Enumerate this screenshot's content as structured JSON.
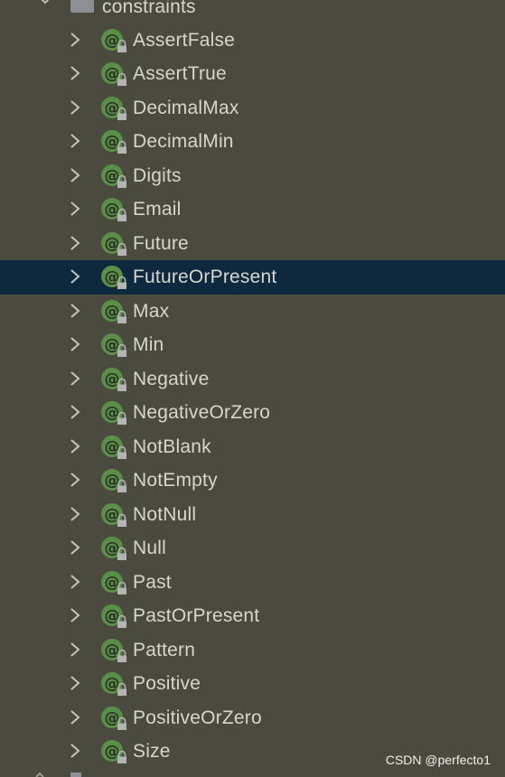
{
  "tree": {
    "folder": {
      "label": "constraints",
      "icon": "folder-icon",
      "expanded": true
    },
    "items": [
      {
        "label": "AssertFalse",
        "icon": "annotation-icon"
      },
      {
        "label": "AssertTrue",
        "icon": "annotation-icon"
      },
      {
        "label": "DecimalMax",
        "icon": "annotation-icon"
      },
      {
        "label": "DecimalMin",
        "icon": "annotation-icon"
      },
      {
        "label": "Digits",
        "icon": "annotation-icon"
      },
      {
        "label": "Email",
        "icon": "annotation-icon"
      },
      {
        "label": "Future",
        "icon": "annotation-icon"
      },
      {
        "label": "FutureOrPresent",
        "icon": "annotation-icon",
        "selected": true
      },
      {
        "label": "Max",
        "icon": "annotation-icon"
      },
      {
        "label": "Min",
        "icon": "annotation-icon"
      },
      {
        "label": "Negative",
        "icon": "annotation-icon"
      },
      {
        "label": "NegativeOrZero",
        "icon": "annotation-icon"
      },
      {
        "label": "NotBlank",
        "icon": "annotation-icon"
      },
      {
        "label": "NotEmpty",
        "icon": "annotation-icon"
      },
      {
        "label": "NotNull",
        "icon": "annotation-icon"
      },
      {
        "label": "Null",
        "icon": "annotation-icon"
      },
      {
        "label": "Past",
        "icon": "annotation-icon"
      },
      {
        "label": "PastOrPresent",
        "icon": "annotation-icon"
      },
      {
        "label": "Pattern",
        "icon": "annotation-icon"
      },
      {
        "label": "Positive",
        "icon": "annotation-icon"
      },
      {
        "label": "PositiveOrZero",
        "icon": "annotation-icon"
      },
      {
        "label": "Size",
        "icon": "annotation-icon"
      }
    ]
  },
  "colors": {
    "background": "#4b4a3f",
    "selection": "#0e293e",
    "text": "#d6d6cf",
    "annotation_badge": "#5a8f47",
    "lock": "#b4b4b4"
  },
  "watermark": "CSDN @perfecto1"
}
